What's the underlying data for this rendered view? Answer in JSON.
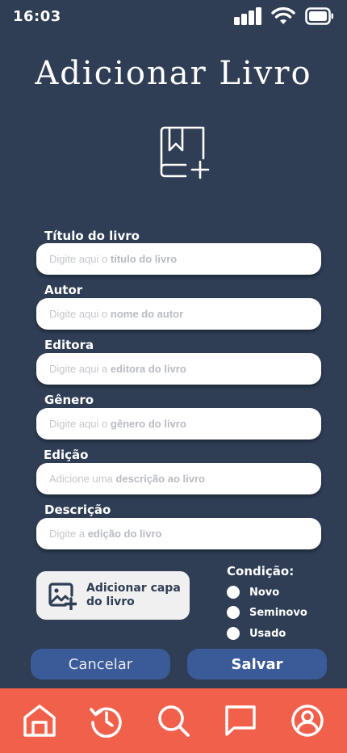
{
  "status_bar": {
    "time": "16:03"
  },
  "header": {
    "title": "Adicionar Livro"
  },
  "fields": [
    {
      "label": "Título do livro",
      "placeholder_prefix": "Digite aqui o ",
      "placeholder_bold": "título do livro"
    },
    {
      "label": "Autor",
      "placeholder_prefix": "Digite aqui o ",
      "placeholder_bold": "nome do autor"
    },
    {
      "label": "Editora",
      "placeholder_prefix": "Digite aqui a ",
      "placeholder_bold": "editora do livro"
    },
    {
      "label": "Gênero",
      "placeholder_prefix": "Digite aqui o ",
      "placeholder_bold": "gênero do livro"
    },
    {
      "label": "Edição",
      "placeholder_prefix": "Adicione uma ",
      "placeholder_bold": "descrição ao livro"
    },
    {
      "label": "Descrição",
      "placeholder_prefix": "Digite a ",
      "placeholder_bold": "edição do livro"
    }
  ],
  "cover": {
    "label": "Adicionar capa do livro",
    "icon": "add-image-icon"
  },
  "condition": {
    "title": "Condição:",
    "options": [
      "Novo",
      "Seminovo",
      "Usado"
    ]
  },
  "actions": {
    "cancel_label": "Cancelar",
    "save_label": "Salvar"
  },
  "bottom_nav": {
    "items": [
      "home-icon",
      "history-icon",
      "search-icon",
      "chat-icon",
      "profile-icon"
    ]
  },
  "colors": {
    "background": "#2f3e55",
    "button": "#3b5b98",
    "nav_bar": "#f0604b",
    "input_bg": "#ffffff",
    "cover_button_bg": "#f0f0f0"
  }
}
